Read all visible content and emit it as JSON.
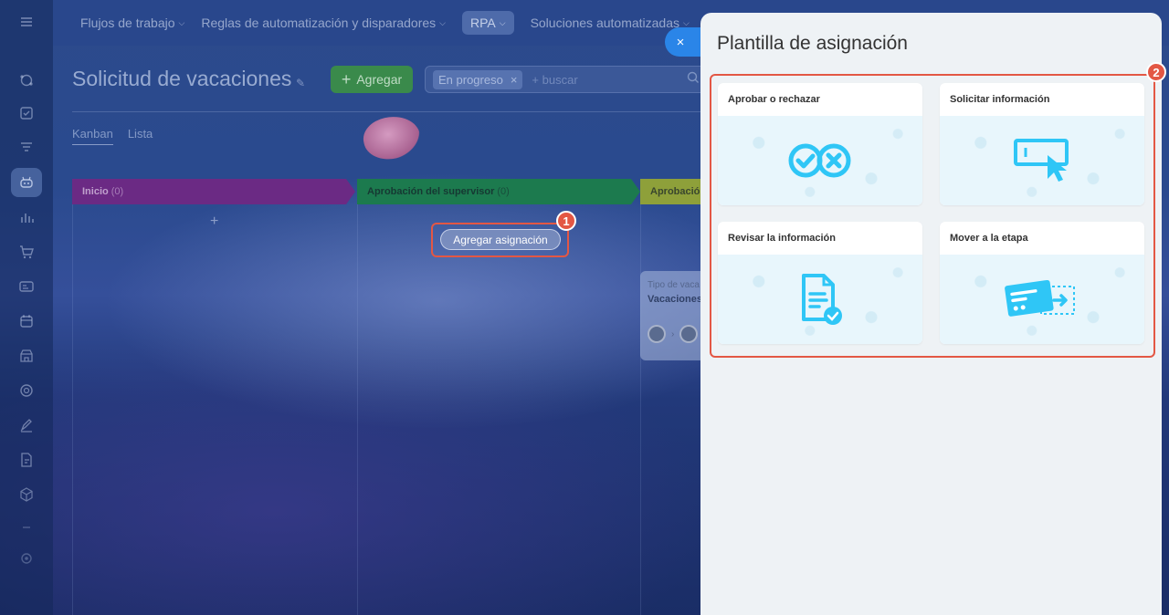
{
  "topnav": {
    "items": [
      {
        "label": "Flujos de trabajo",
        "chevron": true
      },
      {
        "label": "Reglas de automatización y disparadores",
        "chevron": true
      },
      {
        "label": "RPA",
        "chevron": true,
        "active": true
      },
      {
        "label": "Soluciones automatizadas",
        "chevron": true
      }
    ]
  },
  "header": {
    "title": "Solicitud de vacaciones",
    "add_label": "Agregar",
    "filter_chip": "En progreso",
    "filter_remove": "×",
    "search_placeholder": "+ buscar"
  },
  "views": {
    "kanban": "Kanban",
    "list": "Lista"
  },
  "kanban": {
    "stages": [
      {
        "name": "Inicio",
        "count": "(0)",
        "color": "#6b2a84"
      },
      {
        "name": "Aprobación del supervisor",
        "count": "(0)",
        "color": "#1c7a4e"
      },
      {
        "name": "Aprobació",
        "count": "",
        "color": "#8ea03a"
      }
    ],
    "add_plus": "+",
    "add_assignment": "Agregar asignación",
    "card": {
      "field_label": "Tipo de vaca",
      "field_value": "Vacaciones"
    }
  },
  "badges": {
    "one": "1",
    "two": "2"
  },
  "panel": {
    "close": "×",
    "title": "Plantilla de asignación",
    "templates": [
      {
        "name": "Aprobar o rechazar",
        "icon": "approve-reject-icon"
      },
      {
        "name": "Solicitar información",
        "icon": "request-info-icon"
      },
      {
        "name": "Revisar la información",
        "icon": "review-document-icon"
      },
      {
        "name": "Mover a la etapa",
        "icon": "move-stage-icon"
      }
    ]
  },
  "colors": {
    "accent": "#2fc6f6",
    "highlight": "#e35744",
    "close_button": "#2a85e8"
  }
}
